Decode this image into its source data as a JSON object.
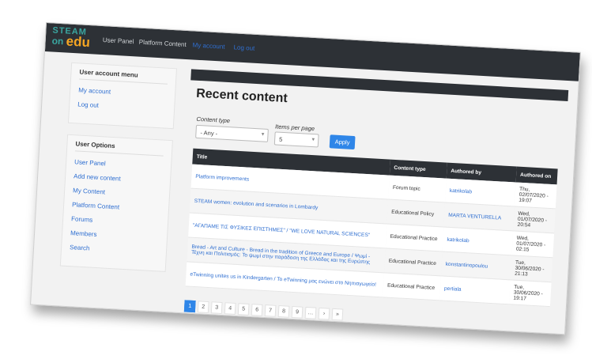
{
  "logo": {
    "line1": "STEAM",
    "line2": "on",
    "line3": "edu"
  },
  "nav": {
    "items": [
      "User Panel",
      "Platform Content",
      "My account",
      "Log out"
    ]
  },
  "sidebar": {
    "account_title": "User account menu",
    "account_links": [
      "My account",
      "Log out"
    ],
    "options_title": "User Options",
    "options_links": [
      "User Panel",
      "Add new content",
      "My Content",
      "Platform Content",
      "Forums",
      "Members",
      "Search"
    ]
  },
  "main": {
    "title": "Recent content",
    "content_type_label": "Content type",
    "content_type_value": "- Any -",
    "items_label": "Items per page",
    "items_value": "5",
    "apply_label": "Apply"
  },
  "table": {
    "headers": [
      "Title",
      "Content type",
      "Authored by",
      "Authored on"
    ],
    "rows": [
      [
        "Platform improvements",
        "Forum topic",
        "katrikolab",
        "Thu, 02/07/2020 - 19:07"
      ],
      [
        "STEAM women: evolution and scenarios in Lombardy",
        "Educational Policy",
        "MARTA VENTURELLA",
        "Wed, 01/07/2020 - 20:54"
      ],
      [
        "\"ΑΓΑΠΑΜΕ ΤΙΣ ΦΥΣΙΚΕΣ ΕΠΙΣΤΗΜΕΣ\" / \"WE LOVE NATURAL SCIENCES\"",
        "Educational Practice",
        "katrikolab",
        "Wed, 01/07/2020 - 02:15"
      ],
      [
        "Bread - Art and Culture - Bread in the tradition of Greece and Europe / Ψωμί - Τέχνη και Πολιτισμός: Το ψωμί στην παράδοση της Ελλάδας και της Ευρώπης",
        "Educational Practice",
        "konstantinopoulou",
        "Tue, 30/06/2020 - 21:13"
      ],
      [
        "eTwinning unites us in Kindergarten / Το eTwinning μας ενώνει στο Νηπιαγωγείο!",
        "Educational Practice",
        "pertiala",
        "Tue, 30/06/2020 - 19:17"
      ]
    ]
  },
  "pager": {
    "pages": [
      "1",
      "2",
      "3",
      "4",
      "5",
      "6",
      "7",
      "8",
      "9",
      "…",
      "›",
      "»"
    ],
    "current": "1"
  },
  "colors": {
    "topbar": "#2d3136",
    "link": "#2f6fd1",
    "button": "#2f86e8",
    "logo_teal": "#3aa6a0",
    "logo_orange": "#f5a623"
  }
}
